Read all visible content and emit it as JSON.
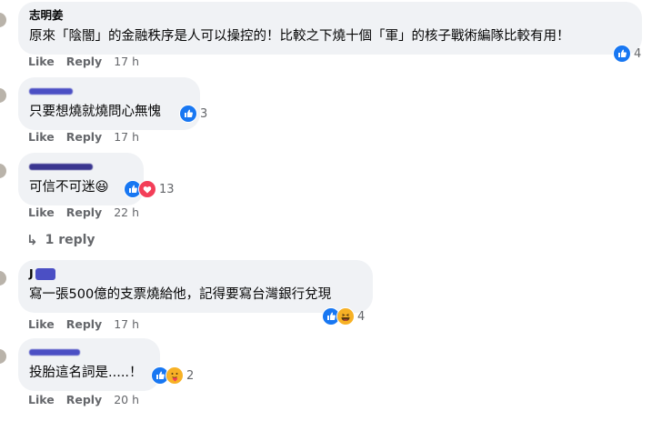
{
  "comments": [
    {
      "author": "志明姜",
      "text": "原來「陰闇」的金融秩序是人可以操控的！比較之下燒十個「軍」的核子戰術編隊比較有用！",
      "reactions": {
        "icons": [
          "like-icon"
        ],
        "count": "4"
      },
      "actions": {
        "like": "Like",
        "reply": "Reply",
        "time": "17 h"
      }
    },
    {
      "author": "",
      "text": "只要想燒就燒問心無愧",
      "reactions": {
        "icons": [
          "like-icon"
        ],
        "count": "3"
      },
      "actions": {
        "like": "Like",
        "reply": "Reply",
        "time": "17 h"
      }
    },
    {
      "author": "",
      "text": "可信不可迷😆",
      "reactions": {
        "icons": [
          "like-icon",
          "love-icon"
        ],
        "count": "13"
      },
      "actions": {
        "like": "Like",
        "reply": "Reply",
        "time": "22 h"
      },
      "replies_link": "1 reply"
    },
    {
      "author": "J",
      "text": "寫一張500億的支票燒給他，記得要寫台灣銀行兌現",
      "reactions": {
        "icons": [
          "like-icon",
          "haha-icon"
        ],
        "count": "4"
      },
      "actions": {
        "like": "Like",
        "reply": "Reply",
        "time": "17 h"
      }
    },
    {
      "author": "",
      "text": "投胎這名詞是.....！",
      "reactions": {
        "icons": [
          "like-icon",
          "care-icon"
        ],
        "count": "2"
      },
      "actions": {
        "like": "Like",
        "reply": "Reply",
        "time": "20 h"
      }
    }
  ],
  "colors": {
    "bubble": "#f0f2f5",
    "like_blue": "#1877f2",
    "love_red": "#f33e58",
    "haha_yellow": "#f7b125",
    "meta_gray": "#65676b",
    "redaction": "#4b4fc4"
  }
}
